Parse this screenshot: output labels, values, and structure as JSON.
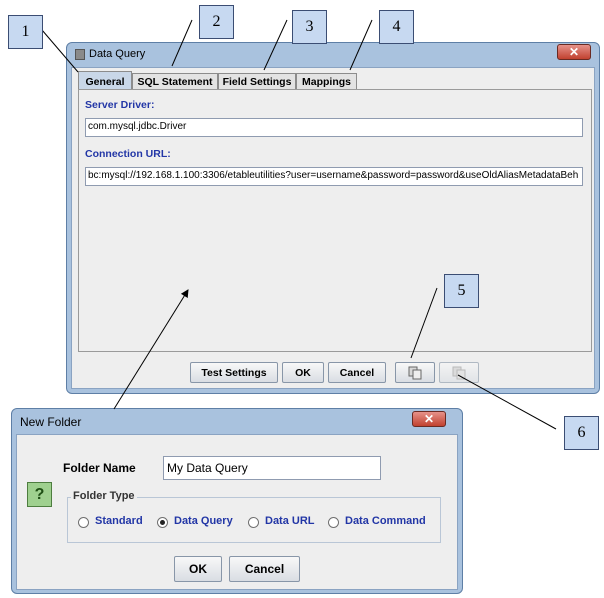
{
  "callouts": [
    "1",
    "2",
    "3",
    "4",
    "5",
    "6"
  ],
  "data_query_window": {
    "title": "Data Query",
    "close_symbol": "✕",
    "tabs": [
      "General",
      "SQL Statement",
      "Field Settings",
      "Mappings"
    ],
    "active_tab": "General",
    "server_driver_label": "Server Driver:",
    "server_driver_value": "com.mysql.jdbc.Driver",
    "connection_url_label": "Connection URL:",
    "connection_url_value": "bc:mysql://192.168.1.100:3306/etableutilities?user=username&password=password&useOldAliasMetadataBeh",
    "buttons": {
      "test_settings": "Test Settings",
      "ok": "OK",
      "cancel": "Cancel"
    },
    "icons": [
      "copy-icon",
      "paste-icon"
    ]
  },
  "new_folder_dialog": {
    "title": "New Folder",
    "close_symbol": "✕",
    "help_symbol": "?",
    "folder_name_label": "Folder Name",
    "folder_name_value": "My Data Query",
    "folder_type_label": "Folder Type",
    "folder_types": [
      "Standard",
      "Data Query",
      "Data URL",
      "Data Command"
    ],
    "selected_type": "Data Query",
    "buttons": {
      "ok": "OK",
      "cancel": "Cancel"
    }
  }
}
